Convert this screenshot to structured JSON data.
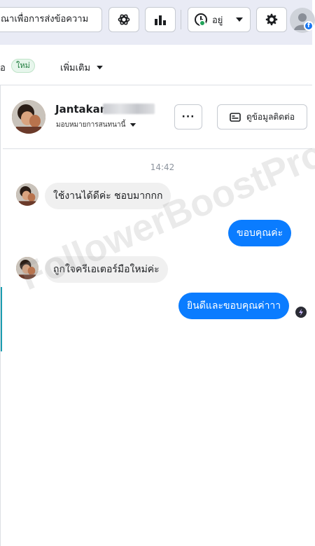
{
  "topbar": {
    "promo_label": "ณาเพื่อการส่งข้อความ",
    "status_label": "อยู่"
  },
  "tabs": {
    "cut_label": "อ",
    "new_badge": "ใหม่",
    "more_label": "เพิ่มเติม"
  },
  "contact": {
    "name": "Jantakan",
    "assign_label": "มอบหมายการสนทนานี้",
    "more_label": "···",
    "view_contact_label": "ดูข้อมูลติดต่อ"
  },
  "conversation": {
    "timestamp": "14:42",
    "messages": [
      {
        "direction": "in",
        "text": "ใช้งานได้ดีค่ะ ชอบมากกก"
      },
      {
        "direction": "out",
        "text": "ขอบคุณค่ะ"
      },
      {
        "direction": "in",
        "text": "ถูกใจครีเอเตอร์มือใหม่ค่ะ"
      },
      {
        "direction": "out",
        "text": "ยินดีและขอบคุณค่าาา"
      }
    ]
  },
  "watermark": "FollowerBoostPro",
  "colors": {
    "accent": "#0a7cff",
    "online": "#22a35a",
    "facebook": "#1877f2"
  }
}
